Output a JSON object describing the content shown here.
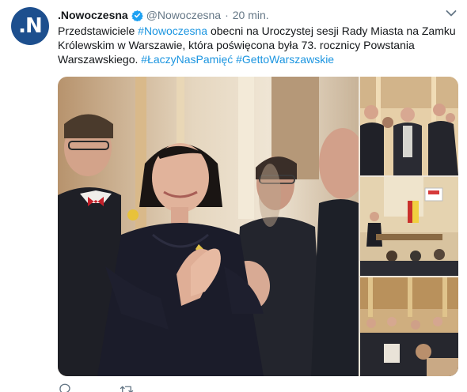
{
  "account": {
    "display_name": ".Nowoczesna",
    "handle": "@Nowoczesna",
    "separator": "·",
    "timestamp": "20 min.",
    "avatar_letter": ".N",
    "avatar_color": "#1d4f8e",
    "verified": true
  },
  "tweet": {
    "segments": [
      {
        "text": "Przedstawiciele ",
        "type": "text"
      },
      {
        "text": "#Nowoczesna",
        "type": "hashtag"
      },
      {
        "text": " obecni na Uroczystej sesji Rady Miasta na Zamku Królewskim w Warszawie, która poświęcona była 73. rocznicy Powstania Warszawskiego. ",
        "type": "text"
      },
      {
        "text": "#ŁaczyNasPamięć",
        "type": "hashtag"
      },
      {
        "text": " ",
        "type": "text"
      },
      {
        "text": "#GettoWarszawskie",
        "type": "hashtag"
      }
    ]
  },
  "media": {
    "count": 4,
    "photos": [
      "main-photo",
      "side-photo-1",
      "side-photo-2",
      "side-photo-3"
    ]
  },
  "icons": {
    "menu": "chevron-down-icon",
    "verified": "verified-badge-icon",
    "reply": "reply-icon",
    "retweet": "retweet-icon"
  },
  "colors": {
    "link": "#1b95e0",
    "secondary_text": "#657786",
    "verified": "#1da1f2"
  }
}
